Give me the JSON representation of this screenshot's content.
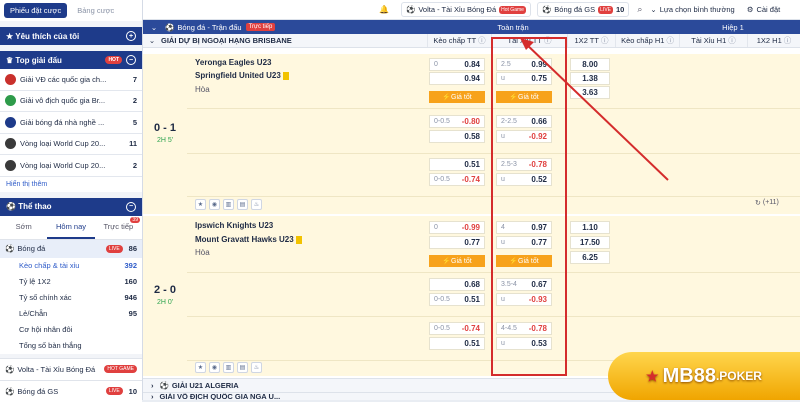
{
  "sidebar": {
    "tab_bet_slip": "Phiếu đặt cược",
    "tab_odds": "Bảng cược",
    "favorites": "Yêu thích của tôi",
    "top_leagues": "Top giải đấu",
    "hot": "HOT",
    "leagues": [
      {
        "name": "Giải VĐ các quốc gia ch...",
        "count": "7",
        "color": "#c9302c"
      },
      {
        "name": "Giải vô địch quốc gia Br...",
        "count": "2",
        "color": "#2e9b4a"
      },
      {
        "name": "Giải bóng đá nhà nghề ...",
        "count": "5",
        "color": "#1e3b8a"
      },
      {
        "name": "Vòng loại World Cup 20...",
        "count": "11",
        "color": "#3a3a3a"
      },
      {
        "name": "Vòng loại World Cup 20...",
        "count": "2",
        "color": "#3a3a3a"
      }
    ],
    "show_more": "Hiển thị thêm",
    "sports": "Thể thao",
    "sport_tabs": [
      "Sớm",
      "Hôm nay",
      "Trực tiếp"
    ],
    "live_badge": "39",
    "football": "Bóng đá",
    "football_live": "LIVE",
    "football_count": "86",
    "markets": [
      {
        "name": "Kèo chấp & tài xỉu",
        "count": "392"
      },
      {
        "name": "Tỷ lệ 1X2",
        "count": "160"
      },
      {
        "name": "Tỷ số chính xác",
        "count": "946"
      },
      {
        "name": "Lẻ/Chẵn",
        "count": "95"
      },
      {
        "name": "Cơ hội nhân đôi",
        "count": ""
      },
      {
        "name": "Tổng số bàn thắng",
        "count": ""
      }
    ],
    "volta": "Volta - Tài Xỉu Bóng Đá",
    "volta_badge": "HOT GAME",
    "gs": "Bóng đá GS",
    "gs_badge": "LIVE",
    "gs_count": "10"
  },
  "topbar": {
    "volta": "Volta - Tài Xỉu Bóng Đá",
    "hot": "Hot Game",
    "gs": "Bóng đá GS",
    "live": "LIVE",
    "gs_count": "10",
    "select": "Lựa chọn bình thường",
    "settings": "Cài đặt"
  },
  "table": {
    "sport": "Bóng đá - Trận đấu",
    "live": "Trực tiếp",
    "full_match": "Toàn trận",
    "half1": "Hiệp 1",
    "league": "GIẢI DỰ BỊ NGOẠI HẠNG BRISBANE",
    "cols": [
      "Kèo chấp TT",
      "Tài Xỉu TT",
      "1X2 TT",
      "Kèo chấp H1",
      "Tài Xỉu H1",
      "1X2 H1"
    ],
    "good_price": "Giá tốt",
    "more": "(+11)",
    "next_league": "GIẢI U21 ALGERIA",
    "next_league2": "GIẢI VÔ ĐỊCH QUỐC GIA NGA U..."
  },
  "matches": [
    {
      "home": "Yeronga Eagles U23",
      "away": "Springfield United U23",
      "draw": "Hòa",
      "score": "0 - 1",
      "time": "2H 5'",
      "rows": [
        {
          "hc_h": "0",
          "hc1": "0.84",
          "hc2": "0.94",
          "ou_h": "2.5",
          "ou1": "0.99",
          "ou_u": "u",
          "ou2": "0.75",
          "x1": "8.00",
          "x2": "1.38",
          "x3": "3.63"
        },
        {
          "hc_h": "0-0.5",
          "hc1": "-0.80",
          "hc2": "0.58",
          "ou_h": "2-2.5",
          "ou1": "0.66",
          "ou_u": "u",
          "ou2": "-0.92"
        },
        {
          "hc_h": "",
          "hc1": "0.51",
          "hc2": "-0.74",
          "hc_h2": "0-0.5",
          "ou_h": "2.5-3",
          "ou1": "-0.78",
          "ou_u": "u",
          "ou2": "0.52"
        }
      ]
    },
    {
      "home": "Ipswich Knights U23",
      "away": "Mount Gravatt Hawks U23",
      "draw": "Hòa",
      "score": "2 - 0",
      "time": "2H 0'",
      "rows": [
        {
          "hc_h": "0",
          "hc1": "-0.99",
          "hc2": "0.77",
          "ou_h": "4",
          "ou1": "0.97",
          "ou_u": "u",
          "ou2": "0.77",
          "x1": "1.10",
          "x2": "17.50",
          "x3": "6.25"
        },
        {
          "hc_h": "",
          "hc1": "0.68",
          "hc2": "0.51",
          "hc_h2": "0-0.5",
          "ou_h": "3.5-4",
          "ou1": "0.67",
          "ou_u": "u",
          "ou2": "-0.93"
        },
        {
          "hc_h": "0-0.5",
          "hc1": "-0.74",
          "hc2": "0.51",
          "ou_h": "4-4.5",
          "ou1": "-0.78",
          "ou_u": "u",
          "ou2": "0.53"
        }
      ]
    }
  ],
  "logo": {
    "brand": "MB88",
    "suffix": ".POKER"
  }
}
